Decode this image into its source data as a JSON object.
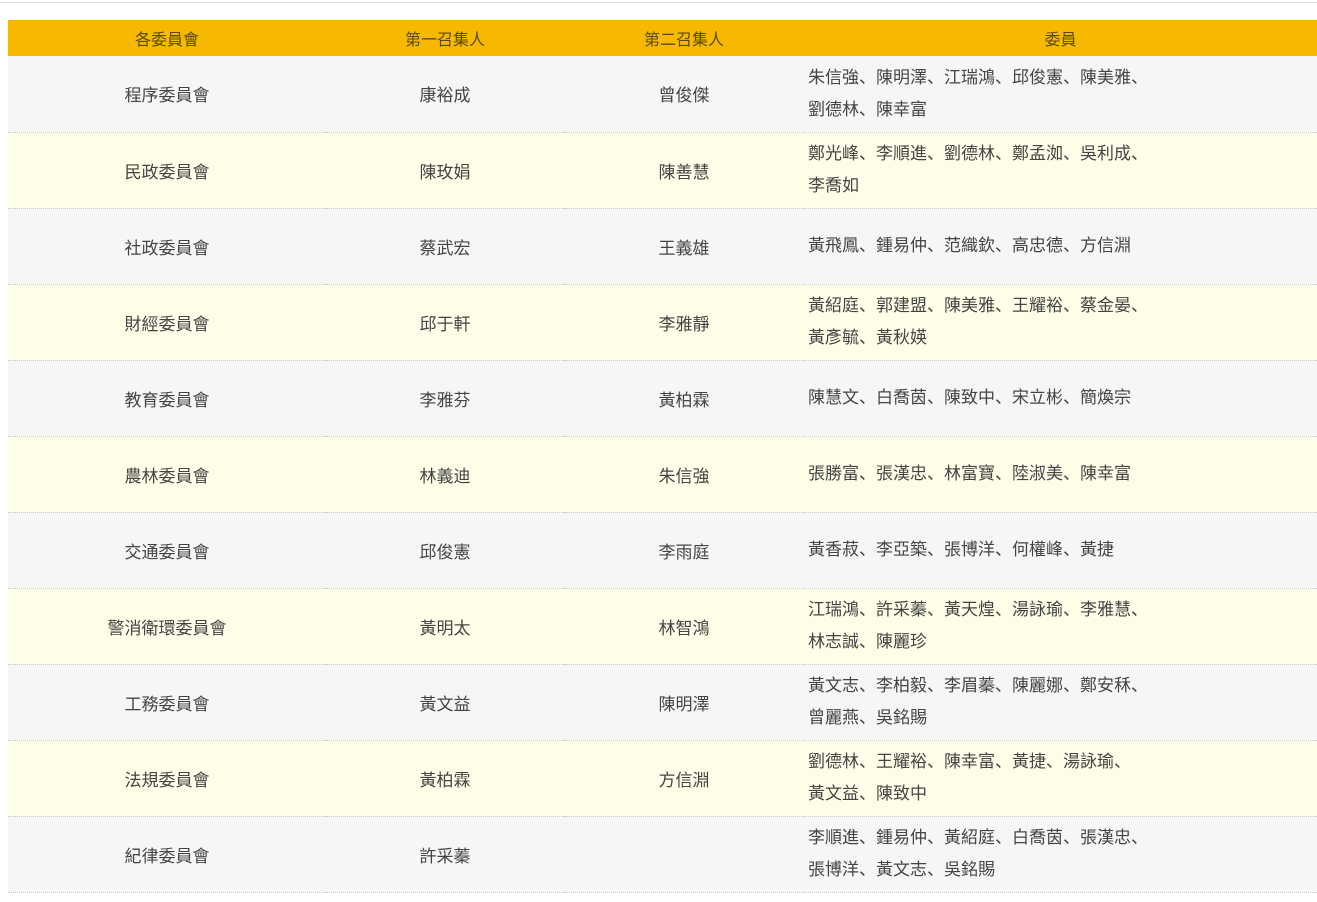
{
  "headers": {
    "committee": "各委員會",
    "convener1": "第一召集人",
    "convener2": "第二召集人",
    "members": "委員"
  },
  "rows": [
    {
      "committee": "程序委員會",
      "convener1": "康裕成",
      "convener2": "曾俊傑",
      "members": [
        "朱信強、陳明澤、江瑞鴻、邱俊憲、陳美雅、",
        "劉德林、陳幸富"
      ]
    },
    {
      "committee": "民政委員會",
      "convener1": "陳玫娟",
      "convener2": "陳善慧",
      "members": [
        "鄭光峰、李順進、劉德林、鄭孟洳、吳利成、",
        "李喬如"
      ]
    },
    {
      "committee": "社政委員會",
      "convener1": "蔡武宏",
      "convener2": "王義雄",
      "members": [
        "黃飛鳳、鍾易仲、范織欽、高忠德、方信淵"
      ]
    },
    {
      "committee": "財經委員會",
      "convener1": "邱于軒",
      "convener2": "李雅靜",
      "members": [
        "黃紹庭、郭建盟、陳美雅、王耀裕、蔡金晏、",
        "黃彥毓、黃秋媖"
      ]
    },
    {
      "committee": "教育委員會",
      "convener1": "李雅芬",
      "convener2": "黃柏霖",
      "members": [
        "陳慧文、白喬茵、陳致中、宋立彬、簡煥宗"
      ]
    },
    {
      "committee": "農林委員會",
      "convener1": "林義迪",
      "convener2": "朱信強",
      "members": [
        "張勝富、張漢忠、林富寶、陸淑美、陳幸富"
      ]
    },
    {
      "committee": "交通委員會",
      "convener1": "邱俊憲",
      "convener2": "李雨庭",
      "members": [
        "黃香菽、李亞築、張博洋、何權峰、黃捷"
      ]
    },
    {
      "committee": "警消衛環委員會",
      "convener1": "黃明太",
      "convener2": "林智鴻",
      "members": [
        "江瑞鴻、許采蓁、黃天煌、湯詠瑜、李雅慧、",
        "林志誠、陳麗珍"
      ]
    },
    {
      "committee": "工務委員會",
      "convener1": "黃文益",
      "convener2": "陳明澤",
      "members": [
        "黃文志、李柏毅、李眉蓁、陳麗娜、鄭安秝、",
        "曾麗燕、吳銘賜"
      ]
    },
    {
      "committee": "法規委員會",
      "convener1": "黃柏霖",
      "convener2": "方信淵",
      "members": [
        "劉德林、王耀裕、陳幸富、黃捷、湯詠瑜、",
        "黃文益、陳致中"
      ]
    },
    {
      "committee": "紀律委員會",
      "convener1": "許采蓁",
      "convener2": "",
      "members": [
        "李順進、鍾易仲、黃紹庭、白喬茵、張漢忠、",
        "張博洋、黃文志、吳銘賜"
      ]
    }
  ],
  "colors": {
    "header_bg": "#f7b900",
    "row_odd_bg": "#f6f6f6",
    "row_even_bg": "#fefee8"
  }
}
